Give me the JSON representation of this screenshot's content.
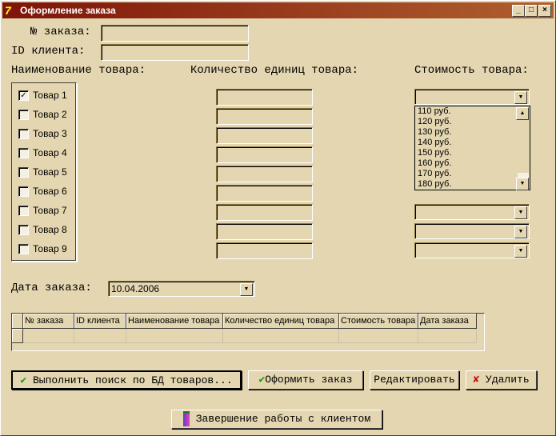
{
  "window": {
    "title": "Оформление заказа",
    "app_icon": "7",
    "min": "_",
    "max": "□",
    "close": "×"
  },
  "labels": {
    "order_no": "№ заказа:",
    "client_id": "ID клиента:",
    "product_name": "Наименование товара:",
    "qty": "Количество единиц товара:",
    "price": "Стоимость товара:",
    "order_date": "Дата заказа:"
  },
  "fields": {
    "order_no": "",
    "client_id": ""
  },
  "products": [
    {
      "label": "Товар 1",
      "checked": true
    },
    {
      "label": "Товар 2",
      "checked": false
    },
    {
      "label": "Товар 3",
      "checked": false
    },
    {
      "label": "Товар 4",
      "checked": false
    },
    {
      "label": "Товар 5",
      "checked": false
    },
    {
      "label": "Товар 6",
      "checked": false
    },
    {
      "label": "Товар 7",
      "checked": false
    },
    {
      "label": "Товар 8",
      "checked": false
    },
    {
      "label": "Товар 9",
      "checked": false
    }
  ],
  "check_mark": "✓",
  "price_dropdown_options": [
    "110 руб.",
    "120 руб.",
    "130 руб.",
    "140 руб.",
    "150 руб.",
    "160 руб.",
    "170 руб.",
    "180 руб."
  ],
  "date_value": "10.04.2006",
  "grid": {
    "columns": [
      "№ заказа",
      "ID клиента",
      "Наименование товара",
      "Количество единиц товара",
      "Стоимость товара",
      "Дата заказа"
    ]
  },
  "buttons": {
    "search": "Выполнить поиск по БД товаров...",
    "order": "Оформить заказ",
    "edit": "Редактировать",
    "delete": "Удалить",
    "finish": "Завершение работы с клиентом"
  },
  "icons": {
    "check": "✔",
    "cross": "✘",
    "down": "▼",
    "up": "▲"
  }
}
